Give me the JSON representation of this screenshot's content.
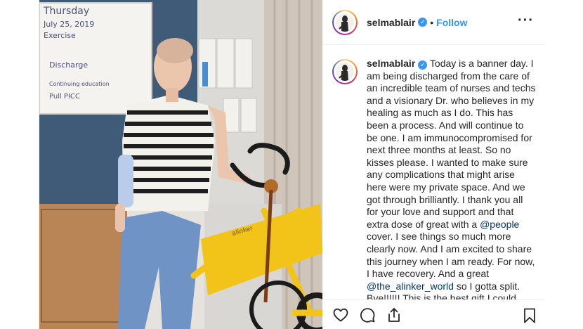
{
  "post": {
    "username": "selmablair",
    "verified_icon": "verified-badge-icon",
    "separator": "•",
    "follow_label": "Follow",
    "more_label": "···",
    "caption_parts": [
      "Today is a banner day. I am being discharged from the care of an incredible team of nurses and techs and a visionary Dr. who believes in my healing as much as I do. This has been a process. And will continue to be one. I am immunocompromised for next three months at least. So no kisses please. I wanted to make sure any complications that might arise here were my private space. And we got through brilliantly. I thank you all for your love and support and that extra dose of great with a ",
      "@people",
      " cover. I see things so much more clearly now. And I am excited to share this journey when I am ready. For now, I have recovery. And a great ",
      "@the_alinker_world",
      " so I gotta split. Bye!!!!!! This is the best gift I could give"
    ],
    "whiteboard": {
      "line1": "Thursday",
      "line2": "July 25, 2019",
      "line3": "Exercise",
      "line4": "Discharge",
      "line5": "Continuing education",
      "line6": "Pull PICC"
    },
    "bike_brand": "alinker",
    "icons": {
      "like": "heart-icon",
      "comment": "comment-icon",
      "share": "share-icon",
      "save": "bookmark-icon"
    },
    "colors": {
      "accent": "#3897f0",
      "mention": "#003569",
      "bike": "#f2c318"
    }
  }
}
